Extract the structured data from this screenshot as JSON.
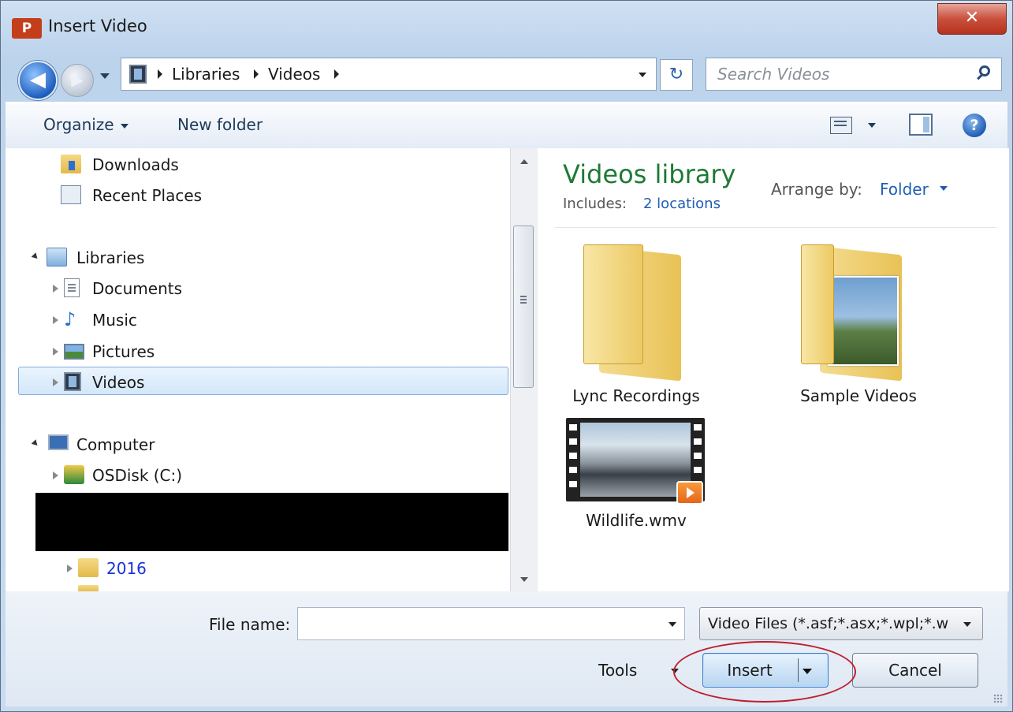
{
  "window": {
    "title": "Insert Video",
    "app_badge": "P",
    "close_glyph": "✕"
  },
  "nav": {
    "back_glyph": "◀",
    "forward_glyph": "▶",
    "breadcrumb": [
      "Libraries",
      "Videos"
    ],
    "refresh_glyph": "↻",
    "search_placeholder": "Search Videos"
  },
  "toolbar": {
    "organize_label": "Organize",
    "new_folder_label": "New folder",
    "help_glyph": "?"
  },
  "tree": {
    "downloads": "Downloads",
    "recent_places": "Recent Places",
    "libraries": "Libraries",
    "documents": "Documents",
    "music": "Music",
    "music_glyph": "♪",
    "pictures": "Pictures",
    "videos": "Videos",
    "computer": "Computer",
    "osdisk": "OSDisk (C:)",
    "folder_2016": "2016"
  },
  "content": {
    "library_title": "Videos library",
    "includes_label": "Includes:",
    "includes_link": "2 locations",
    "arrange_label": "Arrange by:",
    "arrange_value": "Folder",
    "items": [
      {
        "name": "Lync Recordings",
        "type": "folder"
      },
      {
        "name": "Sample Videos",
        "type": "folder"
      },
      {
        "name": "Wildlife.wmv",
        "type": "video"
      }
    ]
  },
  "footer": {
    "file_name_label": "File name:",
    "file_name_value": "",
    "file_type_value": "Video Files (*.asf;*.asx;*.wpl;*.w",
    "tools_label": "Tools",
    "insert_label": "Insert",
    "cancel_label": "Cancel"
  },
  "colors": {
    "accent": "#1f5cb8",
    "library_title": "#1e7a35",
    "highlight_annotation": "#c01f2f",
    "link_2016": "#1a33d8"
  },
  "icons": [
    "back-arrow-icon",
    "forward-arrow-icon",
    "video-library-icon",
    "refresh-icon",
    "search-icon",
    "view-options-icon",
    "preview-pane-icon",
    "help-icon",
    "folder-icon",
    "music-note-icon",
    "computer-icon",
    "disk-icon",
    "play-icon"
  ]
}
